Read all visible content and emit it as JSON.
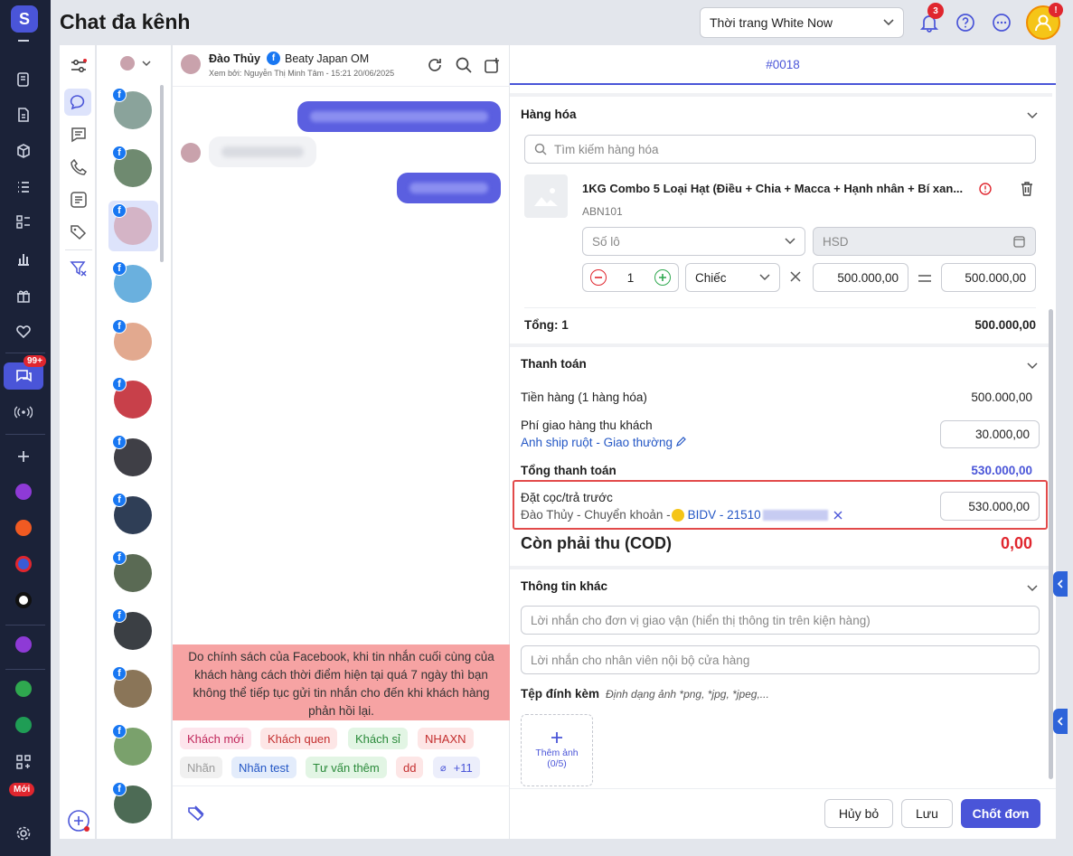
{
  "header": {
    "title": "Chat đa kênh",
    "store": "Thời trang White Now",
    "bell_count": "3",
    "avatar_badge": "!"
  },
  "rail": {
    "badge_99": "99+",
    "badge_moi": "Mới"
  },
  "chat": {
    "name": "Đào Thủy",
    "page": "Beaty Japan OM",
    "meta": "Xem bởi: Nguyễn Thị Minh Tâm - 15:21 20/06/2025",
    "notice": "Do chính sách của Facebook, khi tin nhắn cuối cùng của khách hàng cách thời điểm hiện tại quá 7 ngày thì bạn không thể tiếp tục gửi tin nhắn cho đến khi khách hàng phản hồi lại.",
    "tags": [
      {
        "label": "Khách mới",
        "color": "#c0265a",
        "bg": "#fde5ec"
      },
      {
        "label": "Khách quen",
        "color": "#c42f2f",
        "bg": "#fde6e6"
      },
      {
        "label": "Khách sỉ",
        "color": "#2a8a3a",
        "bg": "#e2f5e4"
      },
      {
        "label": "NHAXN",
        "color": "#c42f2f",
        "bg": "#fde6e6"
      },
      {
        "label": "Nhãn",
        "color": "#9a9a9a",
        "bg": "#f0f0f0"
      },
      {
        "label": "Nhãn test",
        "color": "#2457c5",
        "bg": "#e3ecfb"
      },
      {
        "label": "Tư vấn thêm",
        "color": "#2a8a3a",
        "bg": "#e2f5e4"
      },
      {
        "label": "dd",
        "color": "#c42f2f",
        "bg": "#fde6e6"
      },
      {
        "label": "+11",
        "color": "#4a55d8",
        "bg": "#eceefb"
      }
    ]
  },
  "order": {
    "tab": "#0018",
    "goods": {
      "title": "Hàng hóa",
      "search_placeholder": "Tìm kiếm hàng hóa",
      "product_name": "1KG Combo 5 Loại Hạt (Điều + Chia + Macca + Hạnh nhân + Bí xan...",
      "sku": "ABN101",
      "lot_placeholder": "Số lô",
      "hsd_placeholder": "HSD",
      "qty": "1",
      "unit": "Chiếc",
      "price": "500.000,00",
      "line_total": "500.000,00",
      "total_label": "Tổng: 1",
      "total_value": "500.000,00"
    },
    "payment": {
      "title": "Thanh toán",
      "goods_label": "Tiền hàng (1 hàng hóa)",
      "goods_value": "500.000,00",
      "ship_label": "Phí giao hàng thu khách",
      "ship_value": "30.000,00",
      "ship_carrier": "Anh ship ruột",
      "ship_sep": " - ",
      "ship_type": "Giao thường",
      "total_label": "Tổng thanh toán",
      "total_value": "530.000,00",
      "deposit_label": "Đặt cọc/trả trước",
      "deposit_person": "Đào Thủy - Chuyển khoản - ",
      "deposit_bank": "BIDV - 21510",
      "deposit_value": "530.000,00",
      "cod_label": "Còn phải thu (COD)",
      "cod_value": "0,00"
    },
    "other": {
      "title": "Thông tin khác",
      "carrier_note_placeholder": "Lời nhắn cho đơn vị giao vận (hiển thị thông tin trên kiện hàng)",
      "internal_note_placeholder": "Lời nhắn cho nhân viên nội bộ cửa hàng",
      "attach_label": "Tệp đính kèm",
      "attach_hint": "Định dạng ảnh *png, *jpg, *jpeg,...",
      "add_photo": "Thêm ảnh",
      "photo_count": "(0/5)"
    },
    "buttons": {
      "cancel": "Hủy bỏ",
      "save": "Lưu",
      "confirm": "Chốt đơn"
    }
  },
  "colors": {
    "accent": "#4a55d8",
    "danger": "#e0262e",
    "link": "#2457c5"
  }
}
